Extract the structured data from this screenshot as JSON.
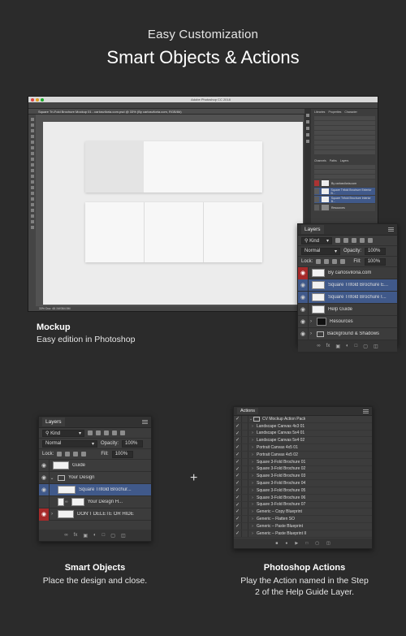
{
  "hero": {
    "subtitle": "Easy Customization",
    "title": "Smart Objects & Actions"
  },
  "photoshop": {
    "app_title": "Adobe Photoshop CC 2018",
    "doc_tab": "Square Tri-Fold Brochure Mockup 01 - carlosviloria.com.psd @ 33% (By carlosviloria.com, RGB/8#)",
    "status": "33%   Doc: 48.1M/364.5M",
    "mini_layers": [
      "By carlosviloria.com",
      "Square Trifold Brochure Exterior B...",
      "Square Trifold Brochure Interior B...",
      "Resources"
    ]
  },
  "layers_main": {
    "tab": "Layers",
    "kind": "Kind",
    "blend": "Normal",
    "opacity_label": "Opacity:",
    "opacity_value": "100%",
    "lock_label": "Lock:",
    "fill_label": "Fill:",
    "fill_value": "100%",
    "layers": [
      "By carlosviloria.com",
      "Square Trifold Brochure E...",
      "Square Trifold Brochure I...",
      "Help Guide",
      "Resources",
      "Background & Shadows"
    ]
  },
  "mockup_caption": {
    "title": "Mockup",
    "text": "Easy edition in Photoshop"
  },
  "layers_small": {
    "tab": "Layers",
    "kind": "Kind",
    "blend": "Normal",
    "opacity_label": "Opacity:",
    "opacity_value": "100%",
    "lock_label": "Lock:",
    "fill_label": "Fill:",
    "fill_value": "100%",
    "layers": [
      "Guide",
      "Your Design",
      "Square Trifold Brochur...",
      "Your Design H...",
      "DON'T DELETE OR HIDE"
    ]
  },
  "plus": "+",
  "actions": {
    "tab": "Actions",
    "pack": "CV Mockup Action Pack",
    "items": [
      "Landscape Canvas 4x3 01",
      "Landscape Canvas 5x4 01",
      "Landscape Canvas 5x4 02",
      "Portrait Canvas 4x5 01",
      "Portrait Canvas 4x5 02",
      "Square 3-Fold Brochure 01",
      "Square 3-Fold Brochure 02",
      "Square 3-Fold Brochure 03",
      "Square 3-Fold Brochure 04",
      "Square 3-Fold Brochure 05",
      "Square 3-Fold Brochure 06",
      "Square 3-Fold Brochure 07",
      "Generic – Copy Blueprint",
      "Generic – Flatten SO",
      "Generic – Paste Blueprint",
      "Generic – Paste Blueprint II"
    ]
  },
  "smart_caption": {
    "title": "Smart Objects",
    "text": "Place the design and close."
  },
  "actions_caption": {
    "title": "Photoshop Actions",
    "line1": "Play the Action named in the Step",
    "line2": "2 of the Help Guide Layer."
  },
  "colors": {
    "background": "#2b2b2b",
    "selected": "#40598a",
    "warning": "#a62a2a"
  }
}
